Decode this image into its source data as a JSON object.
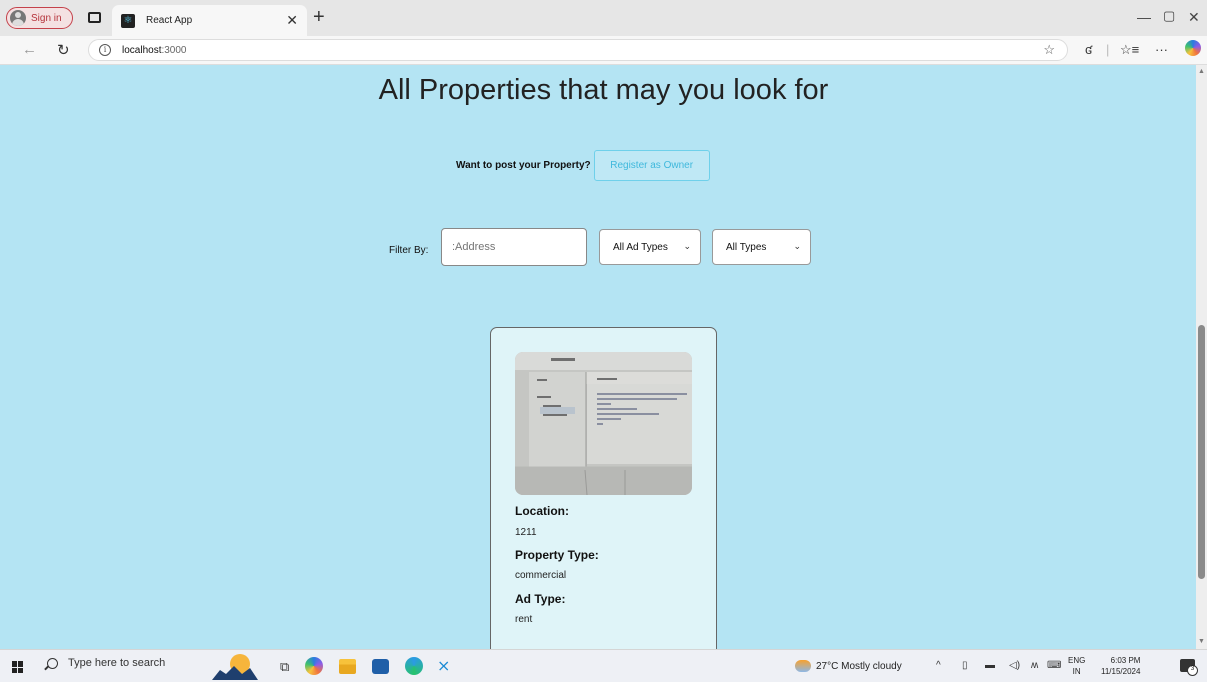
{
  "browser": {
    "profile_button": "Sign in",
    "tab_title": "React App",
    "url_host": "localhost",
    "url_port": ":3000"
  },
  "page": {
    "heading": "All Properties that may you look for",
    "post_question": "Want to post your Property?",
    "register_button": "Register as Owner",
    "filter_label": "Filter By:",
    "address_placeholder": ":Address",
    "ad_type_select": "All Ad Types",
    "type_select": "All Types"
  },
  "property_card": {
    "location_label": "Location:",
    "location_value": "1211",
    "property_type_label": "Property Type:",
    "property_type_value": "commercial",
    "ad_type_label": "Ad Type:",
    "ad_type_value": "rent"
  },
  "taskbar": {
    "search_placeholder": "Type here to search",
    "weather": "27°C  Mostly cloudy",
    "lang_top": "ENG",
    "lang_bottom": "IN",
    "time": "6:03 PM",
    "date": "11/15/2024"
  },
  "colors": {
    "page_background": "#b4e4f3",
    "card_background": "#dff4f8",
    "accent": "#3fb8dc"
  }
}
